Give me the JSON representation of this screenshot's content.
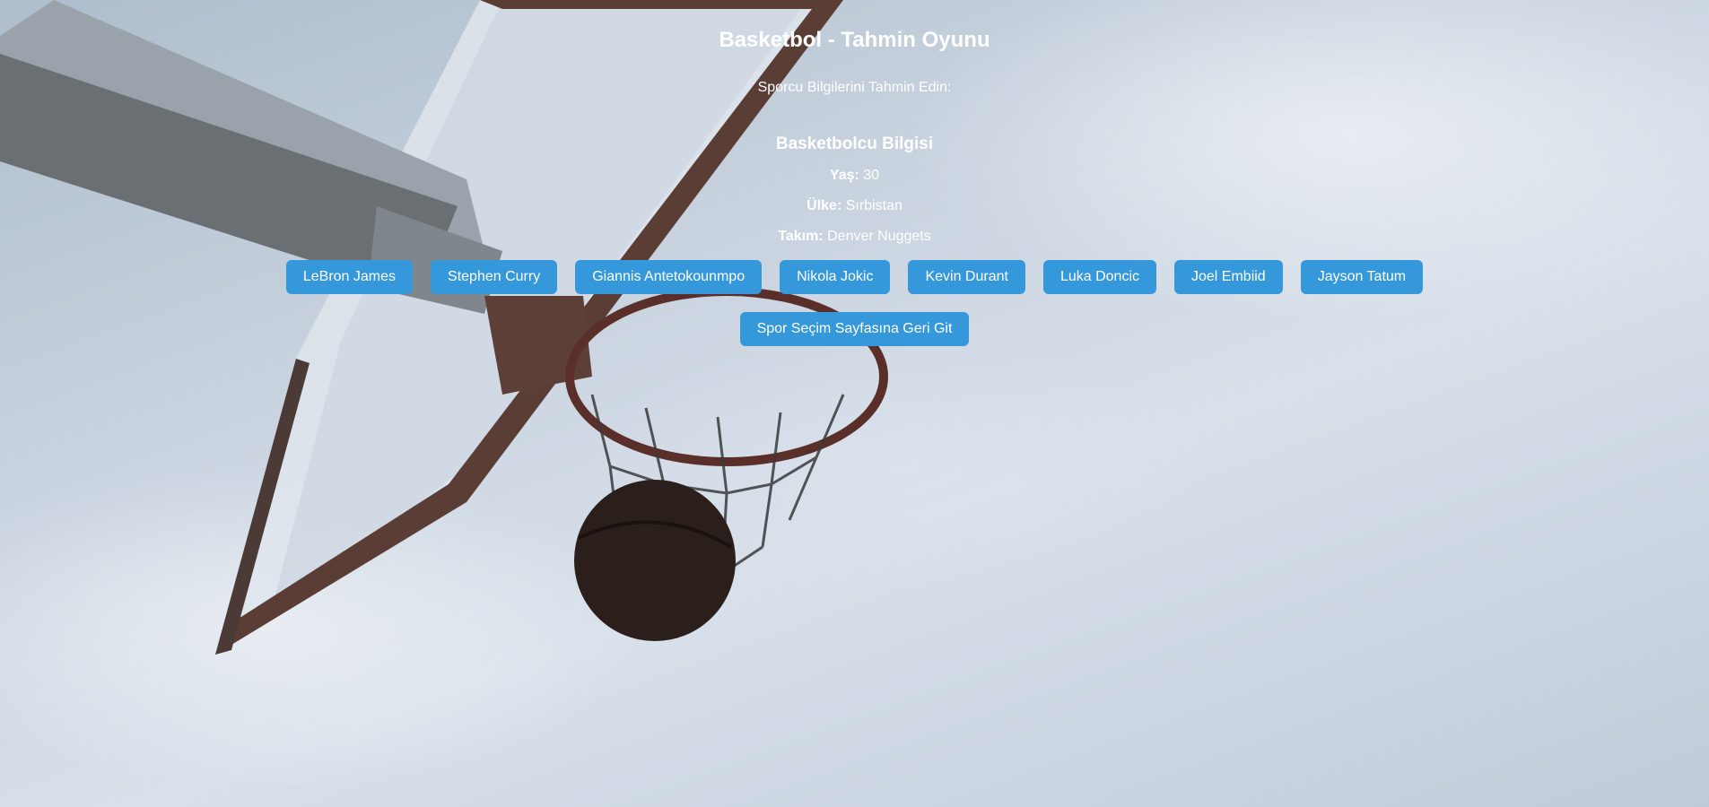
{
  "page": {
    "title": "Basketbol - Tahmin Oyunu",
    "subtitle": "Sporcu Bilgilerini Tahmin Edin:"
  },
  "info": {
    "heading": "Basketbolcu Bilgisi",
    "age_label": "Yaş:",
    "age_value": "30",
    "country_label": "Ülke:",
    "country_value": "Sırbistan",
    "team_label": "Takım:",
    "team_value": "Denver Nuggets"
  },
  "choices": [
    "LeBron James",
    "Stephen Curry",
    "Giannis Antetokounmpo",
    "Nikola Jokic",
    "Kevin Durant",
    "Luka Doncic",
    "Joel Embiid",
    "Jayson Tatum"
  ],
  "back_button": "Spor Seçim Sayfasına Geri Git",
  "colors": {
    "button": "#3498db",
    "text": "#ffffff"
  },
  "background": "basketball-hoop-sky-photo"
}
